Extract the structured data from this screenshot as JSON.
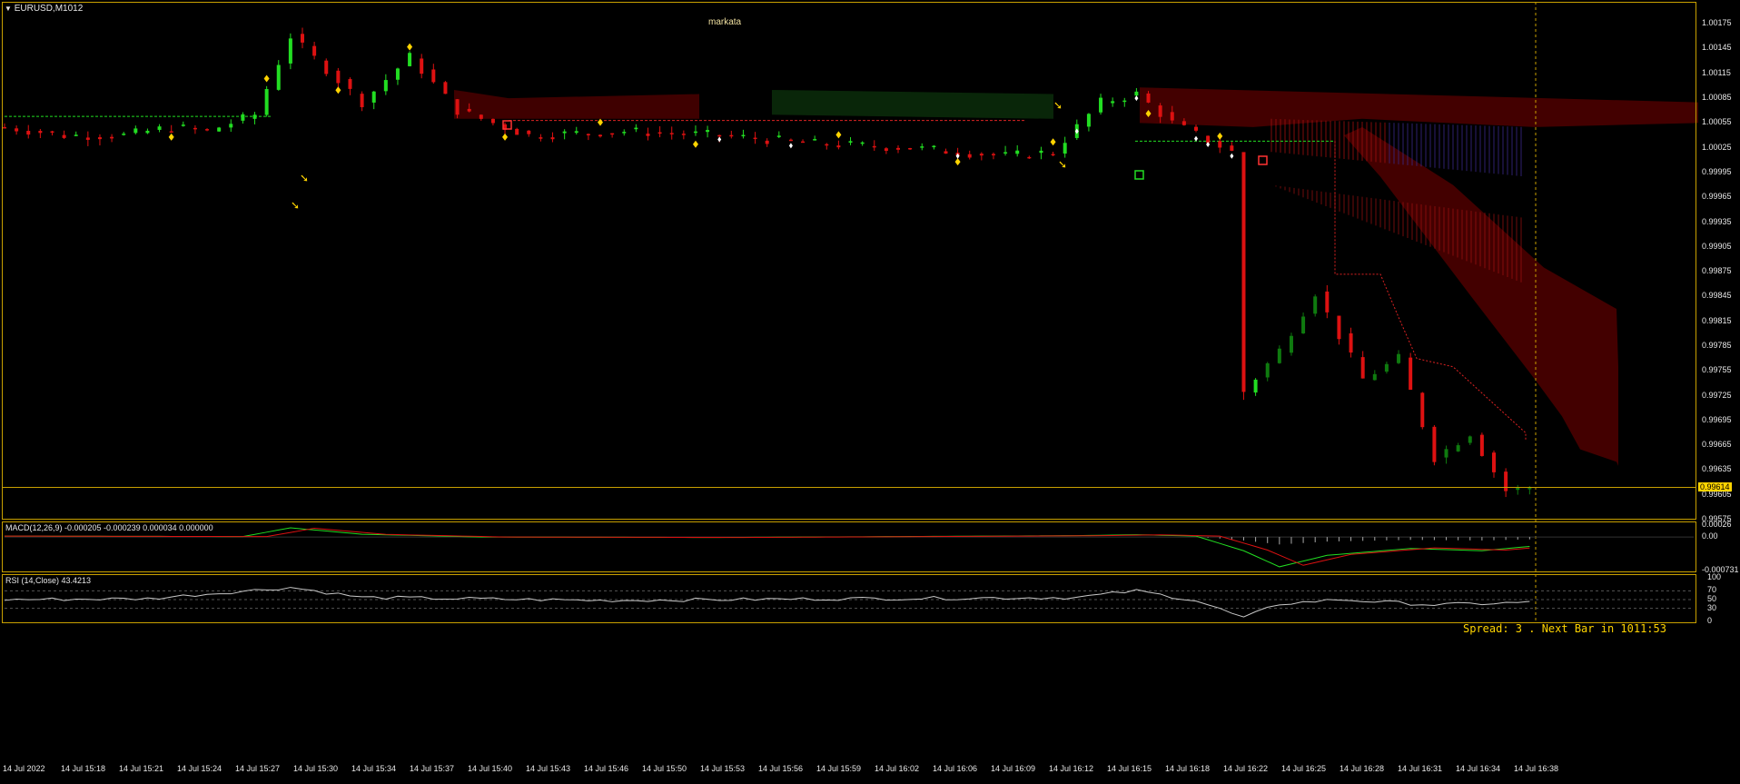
{
  "window": {
    "title": "EURUSD,M1012",
    "indicator_name": "markata"
  },
  "colors": {
    "frame": "#c8a000",
    "bull": "#22dd22",
    "bull_dark": "#0f7a0f",
    "bear": "#dd1111",
    "cloud_red": "#4a0000",
    "cloud_green": "#0a2a0a",
    "signal": "#ffd400",
    "macd_line": "#22dd22",
    "signal_line": "#dd1111",
    "rsi_line": "#c8c8c8",
    "price_label": "#ffd400"
  },
  "status": {
    "spread_text": "Spread: 3 . Next Bar in 1011:53"
  },
  "price_axis": {
    "ticks": [
      "1.00175",
      "1.00145",
      "1.00115",
      "1.00085",
      "1.00055",
      "1.00025",
      "0.99995",
      "0.99965",
      "0.99935",
      "0.99905",
      "0.99875",
      "0.99845",
      "0.99815",
      "0.99785",
      "0.99755",
      "0.99725",
      "0.99695",
      "0.99665",
      "0.99635",
      "0.99605",
      "0.99575"
    ],
    "current_price": "0.99614"
  },
  "macd_panel": {
    "label": "MACD(12,26,9) -0.000205 -0.000239 0.000034 0.000000",
    "ticks": [
      "0.00026",
      "0.00",
      "-0.000731"
    ]
  },
  "rsi_panel": {
    "label": "RSI (14,Close) 43.4213",
    "ticks": [
      "100",
      "70",
      "50",
      "30",
      "0"
    ]
  },
  "time_axis": [
    "14 Jul 2022",
    "14 Jul 15:18",
    "14 Jul 15:21",
    "14 Jul 15:24",
    "14 Jul 15:27",
    "14 Jul 15:30",
    "14 Jul 15:34",
    "14 Jul 15:37",
    "14 Jul 15:40",
    "14 Jul 15:43",
    "14 Jul 15:46",
    "14 Jul 15:50",
    "14 Jul 15:53",
    "14 Jul 15:56",
    "14 Jul 15:59",
    "14 Jul 16:02",
    "14 Jul 16:06",
    "14 Jul 16:09",
    "14 Jul 16:12",
    "14 Jul 16:15",
    "14 Jul 16:18",
    "14 Jul 16:22",
    "14 Jul 16:25",
    "14 Jul 16:28",
    "14 Jul 16:31",
    "14 Jul 16:34",
    "14 Jul 16:38"
  ],
  "chart_data": {
    "type": "candlestick",
    "symbol": "EURUSD",
    "ylim": [
      0.99575,
      1.00195
    ],
    "anchors": [
      {
        "x": 0,
        "y": 1.0005
      },
      {
        "x": 5,
        "y": 1.0004
      },
      {
        "x": 10,
        "y": 1.0004
      },
      {
        "x": 14,
        "y": 1.0005
      },
      {
        "x": 17,
        "y": 1.00045
      },
      {
        "x": 21,
        "y": 1.00065
      },
      {
        "x": 24,
        "y": 1.0016
      },
      {
        "x": 27,
        "y": 1.0012
      },
      {
        "x": 30,
        "y": 1.0008
      },
      {
        "x": 34,
        "y": 1.00135
      },
      {
        "x": 38,
        "y": 1.0007
      },
      {
        "x": 44,
        "y": 1.0004
      },
      {
        "x": 52,
        "y": 1.00045
      },
      {
        "x": 60,
        "y": 1.0004
      },
      {
        "x": 68,
        "y": 1.0003
      },
      {
        "x": 76,
        "y": 1.00025
      },
      {
        "x": 84,
        "y": 1.00015
      },
      {
        "x": 88,
        "y": 1.0002
      },
      {
        "x": 92,
        "y": 1.0008
      },
      {
        "x": 95,
        "y": 1.0009
      },
      {
        "x": 98,
        "y": 1.00055
      },
      {
        "x": 103,
        "y": 1.0002
      },
      {
        "x": 104,
        "y": 0.9973
      },
      {
        "x": 107,
        "y": 0.9978
      },
      {
        "x": 110,
        "y": 0.9985
      },
      {
        "x": 114,
        "y": 0.99745
      },
      {
        "x": 117,
        "y": 0.9977
      },
      {
        "x": 120,
        "y": 0.9965
      },
      {
        "x": 123,
        "y": 0.9968
      },
      {
        "x": 126,
        "y": 0.9961
      },
      {
        "x": 128,
        "y": 0.99614
      }
    ],
    "macd": {
      "ylim": [
        -0.000731,
        0.00026
      ],
      "anchors": [
        {
          "x": 0,
          "y": 2e-05
        },
        {
          "x": 20,
          "y": 1e-05
        },
        {
          "x": 24,
          "y": 0.0002
        },
        {
          "x": 30,
          "y": 6e-05
        },
        {
          "x": 40,
          "y": 0.0
        },
        {
          "x": 60,
          "y": -1e-05
        },
        {
          "x": 90,
          "y": 3e-05
        },
        {
          "x": 95,
          "y": 5e-05
        },
        {
          "x": 100,
          "y": 2e-05
        },
        {
          "x": 104,
          "y": -0.0003
        },
        {
          "x": 107,
          "y": -0.00065
        },
        {
          "x": 111,
          "y": -0.0004
        },
        {
          "x": 118,
          "y": -0.00025
        },
        {
          "x": 124,
          "y": -0.0003
        },
        {
          "x": 128,
          "y": -0.000205
        }
      ]
    },
    "rsi": {
      "ylim": [
        0,
        100
      ],
      "anchors": [
        {
          "x": 0,
          "y": 50
        },
        {
          "x": 12,
          "y": 52
        },
        {
          "x": 24,
          "y": 78
        },
        {
          "x": 30,
          "y": 55
        },
        {
          "x": 50,
          "y": 48
        },
        {
          "x": 70,
          "y": 52
        },
        {
          "x": 90,
          "y": 55
        },
        {
          "x": 95,
          "y": 70
        },
        {
          "x": 100,
          "y": 48
        },
        {
          "x": 104,
          "y": 8
        },
        {
          "x": 107,
          "y": 40
        },
        {
          "x": 112,
          "y": 50
        },
        {
          "x": 120,
          "y": 38
        },
        {
          "x": 128,
          "y": 43.4
        }
      ]
    },
    "legend": "none"
  }
}
